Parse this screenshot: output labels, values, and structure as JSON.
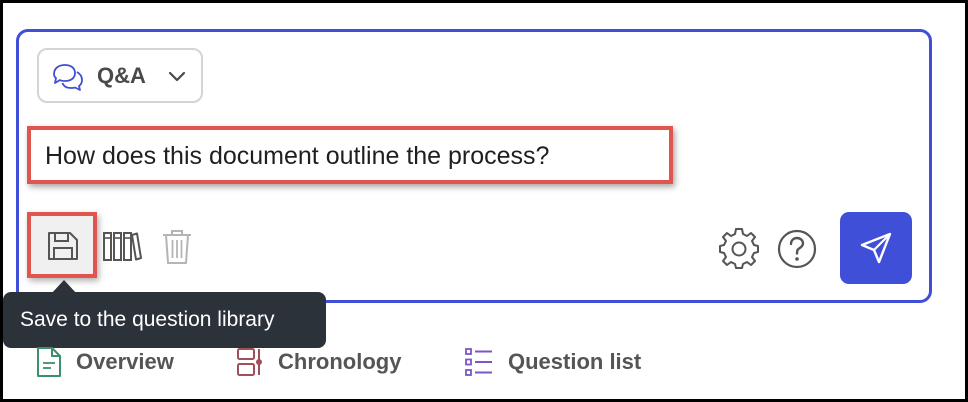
{
  "mode_select": {
    "label": "Q&A",
    "icon": "chat-bubbles-icon"
  },
  "question": {
    "text": "How does this document outline the process?"
  },
  "toolbar": {
    "save": {
      "icon": "floppy-disk-icon"
    },
    "library": {
      "icon": "books-icon"
    },
    "delete": {
      "icon": "trash-icon"
    },
    "settings": {
      "icon": "gear-icon"
    },
    "help": {
      "icon": "question-circle-icon"
    },
    "send": {
      "icon": "paper-plane-icon"
    }
  },
  "tooltip": {
    "text": "Save to the question library"
  },
  "tabs": [
    {
      "label": "Overview",
      "icon": "document-icon",
      "color": "#3b8f6b"
    },
    {
      "label": "Chronology",
      "icon": "timeline-icon",
      "color": "#a0505a"
    },
    {
      "label": "Question list",
      "icon": "list-icon",
      "color": "#7d55c7"
    }
  ],
  "colors": {
    "accent": "#3f4fd8",
    "highlight": "#e0564f",
    "tooltip_bg": "#2c323a"
  }
}
